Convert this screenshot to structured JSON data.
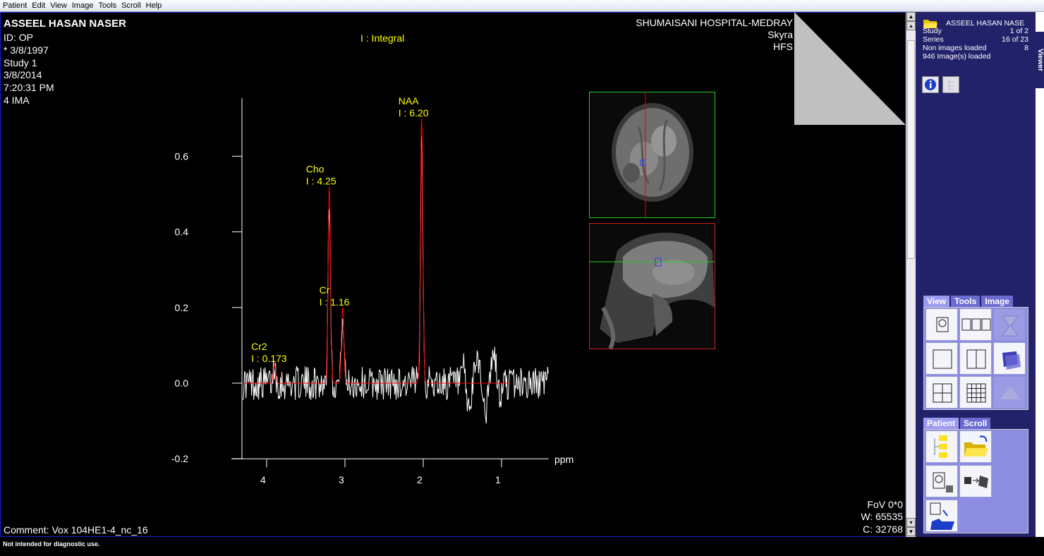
{
  "menu": [
    "Patient",
    "Edit",
    "View",
    "Image",
    "Tools",
    "Scroll",
    "Help"
  ],
  "patient": {
    "name": "ASSEEL HASAN NASER",
    "id": "ID: OP",
    "birth": "* 3/8/1997",
    "study": "Study 1",
    "date": "3/8/2014",
    "time": "7:20:31 PM",
    "ima": "4 IMA"
  },
  "hospital": {
    "name": "SHUMAISANI HOSPITAL-MEDRAY",
    "scanner": "Skyra",
    "position": "HFS"
  },
  "integral_label": "I : Integral",
  "comment": "Comment: Vox 104HE1-4_nc_16",
  "window": {
    "fov": "FoV 0*0",
    "w": "W: 65535",
    "c": "C: 32768"
  },
  "status": "Not intended for diagnostic use.",
  "chart_data": {
    "type": "line",
    "xlabel": "ppm",
    "x_ticks": [
      "4",
      "3",
      "2",
      "1"
    ],
    "y_ticks": [
      "0.6",
      "0.4",
      "0.2",
      "0.0",
      "-0.2"
    ],
    "xlim": [
      4.3,
      0.4
    ],
    "ylim": [
      -0.2,
      0.72
    ],
    "peaks": [
      {
        "name": "NAA",
        "integral": "I : 6.20",
        "ppm": 2.02,
        "height": 0.7
      },
      {
        "name": "Cho",
        "integral": "I : 4.25",
        "ppm": 3.2,
        "height": 0.52
      },
      {
        "name": "Cr",
        "integral": "I : 1.16",
        "ppm": 3.03,
        "height": 0.2
      },
      {
        "name": "Cr2",
        "integral": "I : 0.173",
        "ppm": 3.9,
        "height": 0.05
      }
    ],
    "fit_range": [
      4.3,
      0.9
    ],
    "signal_range": [
      4.3,
      0.4
    ],
    "signal_color": "#ffffff",
    "fit_color": "#ff0000"
  },
  "side": {
    "patient_name": "ASSEEL HASAN NASE",
    "rows": [
      {
        "label": "Study",
        "value": "1 of 2"
      },
      {
        "label": "Series",
        "value": "16 of 23"
      },
      {
        "label": "Non images loaded",
        "value": "8"
      }
    ],
    "loaded": "946 Image(s) loaded",
    "viewer_tab": "Viewer",
    "tab_groups": {
      "top": [
        "View",
        "Tools",
        "Image"
      ],
      "bottom": [
        "Patient",
        "Scroll"
      ]
    }
  }
}
